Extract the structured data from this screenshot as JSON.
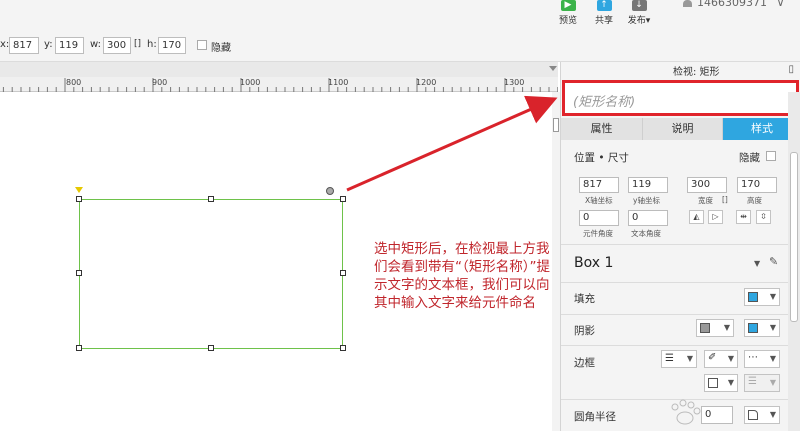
{
  "toolbar": {
    "preview": "预览",
    "share": "共享",
    "publish": "发布▾",
    "user": "1466309371",
    "user_caret": "∨",
    "colors": {
      "preview": "#3bb34a",
      "share": "#2fa6e0",
      "publish": "#777777"
    }
  },
  "position_bar": {
    "x_label": "x:",
    "x_value": "817",
    "y_label": "y:",
    "y_value": "119",
    "w_label": "w:",
    "w_value": "300",
    "h_label": "h:",
    "h_value": "170",
    "link_icon": "[]",
    "hidden_label": "隐藏"
  },
  "ruler": {
    "ticks": [
      "800",
      "900",
      "1000",
      "1100",
      "1200",
      "1300"
    ]
  },
  "annotation": "选中矩形后，在检视最上方我们会看到带有“（矩形名称）”提示文字的文本框，我们可以向其中输入文字来给元件命名",
  "panel": {
    "title": "检视: 矩形",
    "name_placeholder": "(矩形名称)",
    "tabs": [
      "属性",
      "说明",
      "样式"
    ],
    "active_tab": "样式",
    "position_size_label": "位置 • 尺寸",
    "hidden_label": "隐藏",
    "fields": {
      "x": "817",
      "y": "119",
      "w": "300",
      "h": "170",
      "x_sub": "X轴坐标",
      "y_sub": "y轴坐标",
      "w_sub": "宽度",
      "h_sub": "高度",
      "rotation": "0",
      "text_rotation": "0",
      "rotation_sub": "元件角度",
      "text_rotation_sub": "文本角度"
    },
    "style_name": "Box 1",
    "fill_label": "填充",
    "shadow_label": "阴影",
    "border_label": "边框",
    "radius_label": "圆角半径",
    "radius_value": "0",
    "accent": "#2fa6e0"
  }
}
